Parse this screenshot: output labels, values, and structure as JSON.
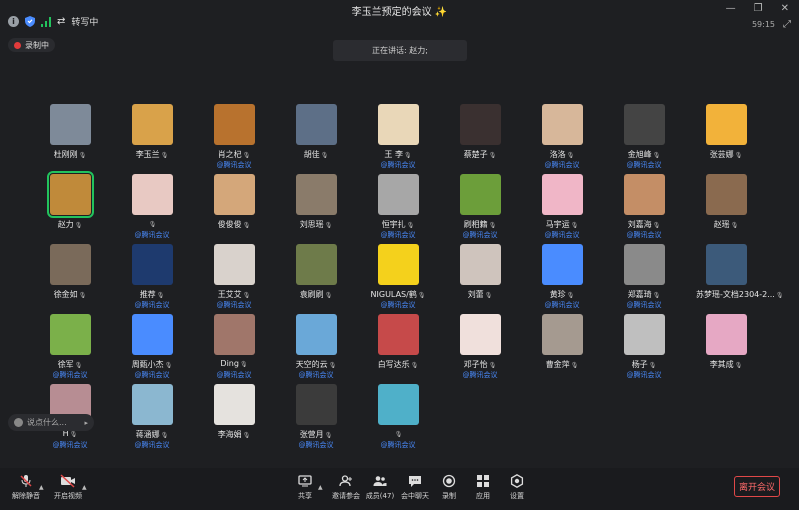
{
  "window": {
    "title": "李玉兰预定的会议 ✨",
    "timer": "59:15",
    "converting": "转写中",
    "recording": "录制中",
    "speaking": "正在讲话: 赵力;"
  },
  "colors": {
    "accent": "#4a8cff",
    "active_speaker": "#22c35d",
    "leave": "#e04848"
  },
  "participants": [
    {
      "name": "杜刚刚",
      "sub": "",
      "color": "#7e8a99",
      "sel": false
    },
    {
      "name": "李玉兰",
      "sub": "",
      "color": "#d9a24a",
      "sel": false
    },
    {
      "name": "肖之杞",
      "sub": "@腾讯会议",
      "color": "#b8722e",
      "sel": false
    },
    {
      "name": "胡佳",
      "sub": "",
      "color": "#5d6f87",
      "sel": false
    },
    {
      "name": "王 李",
      "sub": "@腾讯会议",
      "color": "#e9d7b8",
      "sel": false
    },
    {
      "name": "蔡楚子",
      "sub": "",
      "color": "#3a3030",
      "sel": false
    },
    {
      "name": "洛洛",
      "sub": "@腾讯会议",
      "color": "#d7b79a",
      "sel": false
    },
    {
      "name": "金旭峰",
      "sub": "@腾讯会议",
      "color": "#444444",
      "sel": false
    },
    {
      "name": "张芸娜",
      "sub": "",
      "color": "#f2b23a",
      "sel": false
    },
    {
      "name": "赵力",
      "sub": "",
      "color": "#c08a3a",
      "sel": true
    },
    {
      "name": "",
      "sub": "@腾讯会议",
      "color": "#e8c9c3",
      "sel": false
    },
    {
      "name": "俊俊俊",
      "sub": "",
      "color": "#d4a77a",
      "sel": false
    },
    {
      "name": "刘思瑶",
      "sub": "",
      "color": "#8a7b6a",
      "sel": false
    },
    {
      "name": "恒宇扎",
      "sub": "@腾讯会议",
      "color": "#a7a7a7",
      "sel": false
    },
    {
      "name": "刷相籍",
      "sub": "@腾讯会议",
      "color": "#6c9e3a",
      "sel": false
    },
    {
      "name": "马宇运",
      "sub": "@腾讯会议",
      "color": "#f0b6c7",
      "sel": false
    },
    {
      "name": "刘嘉海",
      "sub": "@腾讯会议",
      "color": "#c48e66",
      "sel": false
    },
    {
      "name": "赵瑶",
      "sub": "",
      "color": "#8a6a4f",
      "sel": false
    },
    {
      "name": "徐金如",
      "sub": "",
      "color": "#7a6a5a",
      "sel": false
    },
    {
      "name": "推荐",
      "sub": "@腾讯会议",
      "color": "#1e3a6e",
      "sel": false
    },
    {
      "name": "王艾艾",
      "sub": "@腾讯会议",
      "color": "#d9d2cc",
      "sel": false
    },
    {
      "name": "袁刷刷",
      "sub": "",
      "color": "#6e7b4a",
      "sel": false
    },
    {
      "name": "NIGULAS/鹤",
      "sub": "@腾讯会议",
      "color": "#f4d11c",
      "sel": false
    },
    {
      "name": "刘蕾",
      "sub": "",
      "color": "#cfc4bd",
      "sel": false
    },
    {
      "name": "黄珍",
      "sub": "@腾讯会议",
      "color": "#4a8cff",
      "sel": false
    },
    {
      "name": "郑嘉琦",
      "sub": "@腾讯会议",
      "color": "#8a8a8a",
      "sel": false
    },
    {
      "name": "苏梦瑶-文档2304-2...",
      "sub": "",
      "color": "#3c5a7a",
      "sel": false
    },
    {
      "name": "徐军",
      "sub": "@腾讯会议",
      "color": "#7bb04a",
      "sel": false
    },
    {
      "name": "周甄小杰",
      "sub": "@腾讯会议",
      "color": "#4a8cff",
      "sel": false
    },
    {
      "name": "Ding",
      "sub": "@腾讯会议",
      "color": "#a0766a",
      "sel": false
    },
    {
      "name": "天空的云",
      "sub": "@腾讯会议",
      "color": "#6aa8d8",
      "sel": false
    },
    {
      "name": "白写达乐",
      "sub": "",
      "color": "#c64a4a",
      "sel": false
    },
    {
      "name": "邓子怡",
      "sub": "@腾讯会议",
      "color": "#f0e0dc",
      "sel": false
    },
    {
      "name": "曹金萍",
      "sub": "",
      "color": "#a59a90",
      "sel": false
    },
    {
      "name": "杨子",
      "sub": "@腾讯会议",
      "color": "#bfbfbf",
      "sel": false
    },
    {
      "name": "李其成",
      "sub": "",
      "color": "#e6a8c4",
      "sel": false
    },
    {
      "name": "H",
      "sub": "@腾讯会议",
      "color": "#b78d93",
      "sel": false
    },
    {
      "name": "蒋涵娜",
      "sub": "@腾讯会议",
      "color": "#8bb7d0",
      "sel": false
    },
    {
      "name": "李海娟",
      "sub": "",
      "color": "#e5e2de",
      "sel": false
    },
    {
      "name": "张营月",
      "sub": "@腾讯会议",
      "color": "#3b3b3b",
      "sel": false
    },
    {
      "name": "",
      "sub": "@腾讯会议",
      "color": "#4fb0c9",
      "sel": false
    }
  ],
  "chat": {
    "placeholder": "说点什么..."
  },
  "toolbar": {
    "mute": "解除静音",
    "video": "开启视频",
    "share": "共享",
    "invite": "邀请参会",
    "members": "成员(47)",
    "chat": "会中聊天",
    "record": "录制",
    "apps": "应用",
    "settings": "设置",
    "leave": "离开会议"
  }
}
